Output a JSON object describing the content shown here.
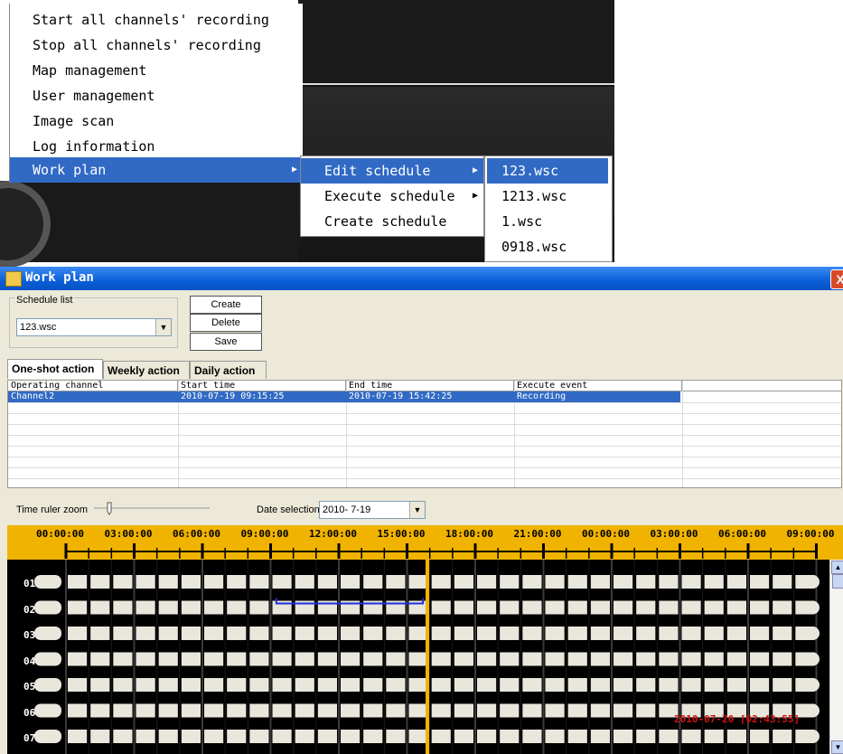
{
  "menu": {
    "items": [
      {
        "label": "Start all channels' recording"
      },
      {
        "label": "Stop all channels' recording"
      },
      {
        "label": "Map management"
      },
      {
        "label": "User management"
      },
      {
        "label": "Image scan"
      },
      {
        "label": "Log information"
      },
      {
        "label": "Work plan",
        "selected": true
      }
    ],
    "work_plan_submenu": [
      {
        "label": "Edit schedule",
        "selected": true
      },
      {
        "label": "Execute schedule"
      },
      {
        "label": "Create schedule"
      }
    ],
    "edit_schedule_files": [
      {
        "label": "123.wsc",
        "selected": true
      },
      {
        "label": "1213.wsc"
      },
      {
        "label": "1.wsc"
      },
      {
        "label": "0918.wsc"
      }
    ],
    "highlight_color": "#316ac5"
  },
  "window": {
    "title": "Work plan",
    "close_symbol": "X",
    "schedule_list": {
      "group_label": "Schedule list",
      "selected": "123.wsc"
    },
    "buttons": {
      "create": "Create",
      "delete": "Delete",
      "save": "Save"
    },
    "tabs": [
      {
        "label": "One-shot action",
        "active": true
      },
      {
        "label": "Weekly action"
      },
      {
        "label": "Daily action"
      }
    ],
    "table": {
      "columns": [
        "Operating channel",
        "Start time",
        "End time",
        "Execute event"
      ],
      "rows": [
        {
          "channel": "Channel2",
          "start": "2010-07-19 09:15:25",
          "end": "2010-07-19 15:42:25",
          "event": "Recording",
          "selected": true
        }
      ]
    },
    "zoom_label": "Time ruler zoom",
    "date_label": "Date selection",
    "date_value": "2010- 7-19",
    "timeline": {
      "ticks": [
        "00:00:00",
        "03:00:00",
        "06:00:00",
        "09:00:00",
        "12:00:00",
        "15:00:00",
        "18:00:00",
        "21:00:00",
        "00:00:00",
        "03:00:00",
        "06:00:00",
        "09:00:00"
      ],
      "channels": [
        "01",
        "02",
        "03",
        "04",
        "05",
        "06",
        "07"
      ],
      "current_time_stamp": "2010-07-20 [02:43:55]",
      "ruler_color": "#f0b300",
      "cursor_color": "#f0b300",
      "stamp_color": "#d01010",
      "schedule_color": "#1c2fe0"
    }
  }
}
